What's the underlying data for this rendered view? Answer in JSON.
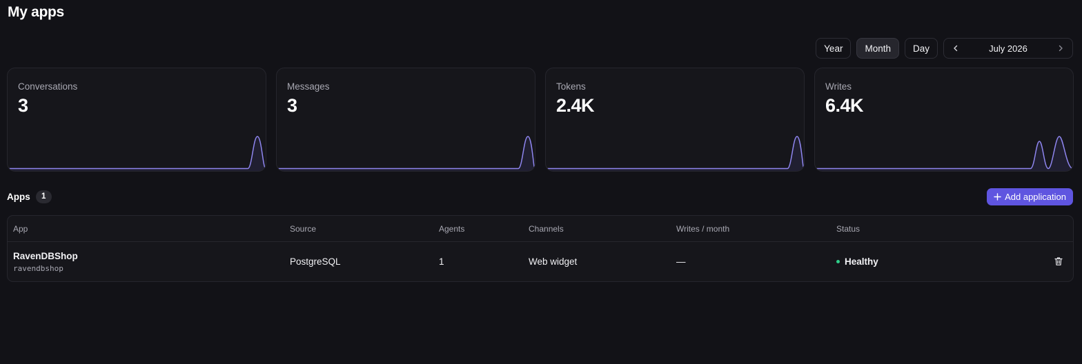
{
  "page": {
    "title": "My apps"
  },
  "period": {
    "options": [
      {
        "label": "Year",
        "active": false
      },
      {
        "label": "Month",
        "active": true
      },
      {
        "label": "Day",
        "active": false
      }
    ],
    "current": "July 2026",
    "prev_icon": "chevron-left-icon",
    "next_icon": "chevron-right-icon"
  },
  "stats": [
    {
      "label": "Conversations",
      "value": "3"
    },
    {
      "label": "Messages",
      "value": "3"
    },
    {
      "label": "Tokens",
      "value": "2.4K"
    },
    {
      "label": "Writes",
      "value": "6.4K"
    }
  ],
  "apps": {
    "title": "Apps",
    "count": "1",
    "add_label": "Add application",
    "add_icon": "plus-icon",
    "columns": [
      "App",
      "Source",
      "Agents",
      "Channels",
      "Writes / month",
      "Status"
    ],
    "rows": [
      {
        "name": "RavenDBShop",
        "slug": "ravendbshop",
        "source": "PostgreSQL",
        "agents": "1",
        "channels": "Web widget",
        "writes": "—",
        "status": "Healthy",
        "delete_icon": "trash-icon"
      }
    ]
  },
  "colors": {
    "accent": "#5f55e0",
    "spark_line": "#8f86f0",
    "status_healthy": "#2fd08a",
    "background": "#121217"
  }
}
